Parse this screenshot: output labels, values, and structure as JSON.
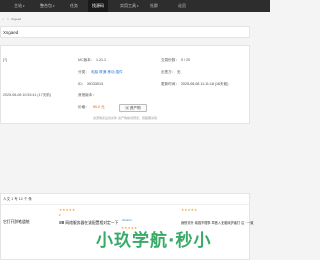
{
  "nav": {
    "items": [
      {
        "label": "主站",
        "caret": "▾"
      },
      {
        "label": "整合包",
        "caret": "▾"
      },
      {
        "label": "任务",
        "caret": ""
      },
      {
        "label": "找源码",
        "caret": "",
        "active": true
      },
      {
        "label": "实用工具",
        "caret": "▾"
      },
      {
        "label": "社群",
        "caret": ""
      },
      {
        "label": "论员",
        "caret": ""
      }
    ]
  },
  "breadcrumb": {
    "home": "⌂",
    "sep": ">",
    "current": "Xsgaed"
  },
  "panel": {
    "title": "Xsgaed"
  },
  "detail": {
    "col1": [
      {
        "label": "[?]"
      },
      {
        "label": "2025-06-08 10:53:41 (17天前)"
      }
    ],
    "version_label": "MC版本：",
    "version_value": "1.21.1",
    "category_label": "分类：",
    "category_value": "电脑 联通 移动 插件",
    "id_label": "ID：",
    "id_value": "XID33013",
    "other_label": "其他版本：",
    "other_value": "",
    "price_label": "价格：",
    "price_value": "¥0.0 元",
    "sales_label": "交易份数：",
    "sales_value": "0 / 20",
    "seller_label": "出售方：",
    "seller_value": "无",
    "updated_label": "更新时间：",
    "updated_value": "2025-06-08 11:11:18 (16天前)",
    "buy_button": "▣ 资产购",
    "note": "资源购买后请文件·资产购前请预览，若超期请到"
  },
  "related": {
    "heading": "人文 1 专 12 个 条",
    "count_label": "",
    "items": [
      {
        "stars": "",
        "category": "",
        "title": "它打开辞笔道统",
        "price": ""
      },
      {
        "stars": "★★★★★",
        "category": "",
        "title": "ⅢⅢ 网络服务器在该配置相对定一下",
        "price": "¥"
      },
      {
        "stars": "★★★★★",
        "category": "Ubuntu",
        "title": "",
        "price": ""
      },
      {
        "stars": "★★★★★",
        "category": "",
        "title": "我别诊升 增强不理事 章音入无脑戏护者打 沿 · 一致",
        "price": ""
      }
    ]
  },
  "watermark": "小玖学航·秒小",
  "colors": {
    "nav_bg": "#2d2d2d",
    "link": "#2b7bd6",
    "price": "#e05b00",
    "star": "#f3a521",
    "watermark": "#27a35a"
  }
}
